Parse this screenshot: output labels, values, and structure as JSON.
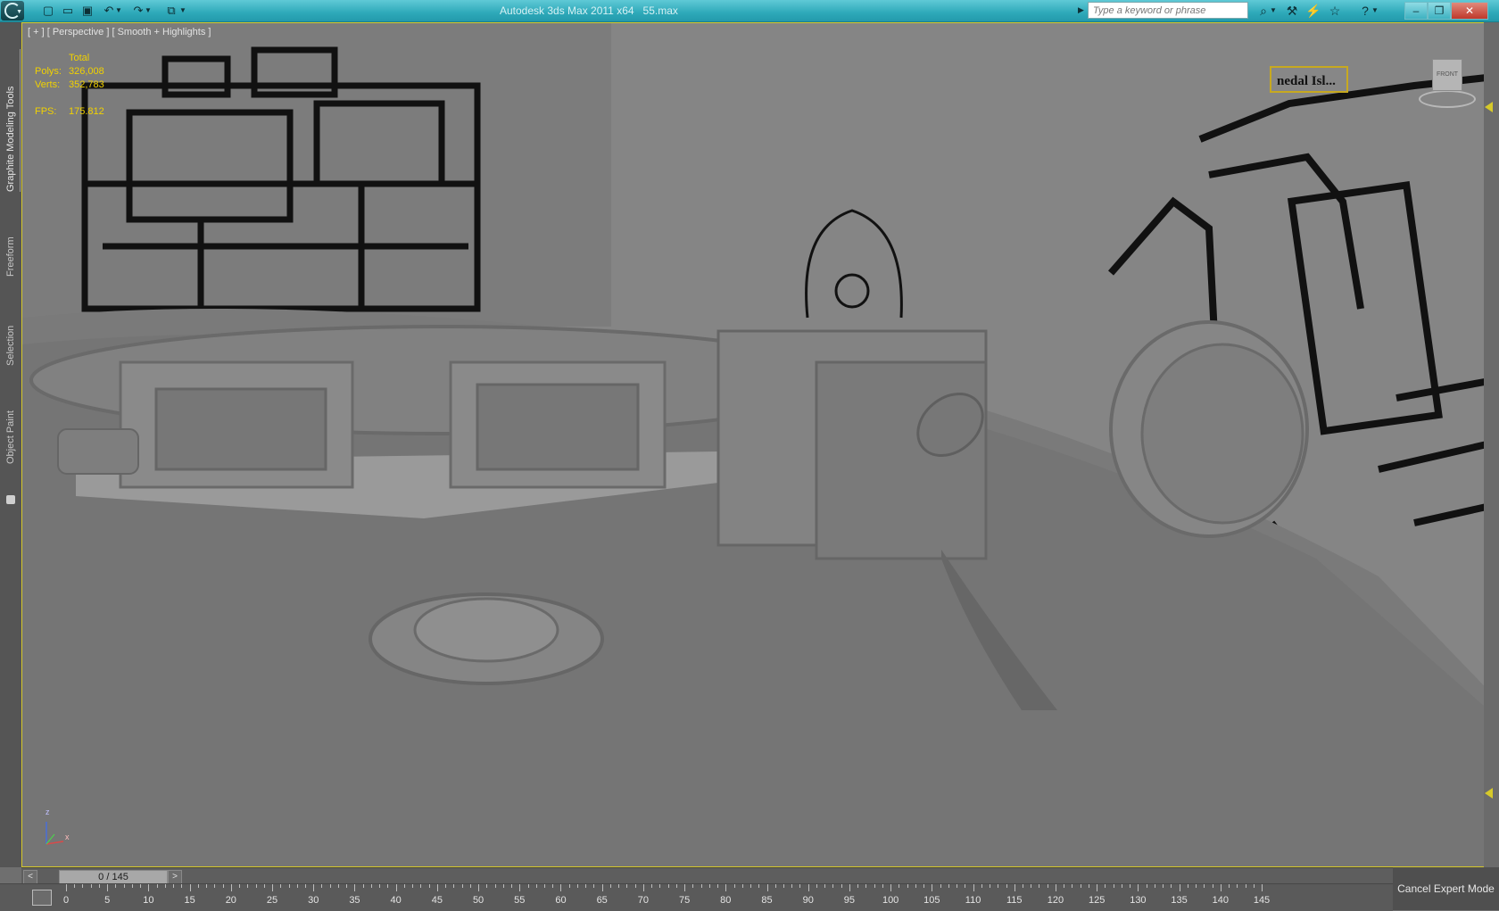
{
  "titlebar": {
    "app_title": "Autodesk 3ds Max  2011 x64",
    "file_name": "55.max",
    "search_placeholder": "Type a keyword or phrase"
  },
  "ribbon_tabs": [
    "Graphite Modeling Tools",
    "Freeform",
    "Selection",
    "Object Paint"
  ],
  "viewport": {
    "label": "[ + ] [ Perspective ] [ Smooth + Highlights ]",
    "stats": {
      "header": "Total",
      "polys_label": "Polys:",
      "polys_value": "326,008",
      "verts_label": "Verts:",
      "verts_value": "352,783",
      "fps_label": "FPS:",
      "fps_value": "175.812"
    },
    "name_overlay": "nedal Isl...",
    "viewcube_label": "FRONT",
    "axis": {
      "z": "z",
      "x": "x"
    }
  },
  "timeline": {
    "frame_display": "0 / 145",
    "prev_label": "<",
    "next_label": ">",
    "ticks": [
      0,
      5,
      10,
      15,
      20,
      25,
      30,
      35,
      40,
      45,
      50,
      55,
      60,
      65,
      70,
      75,
      80,
      85,
      90,
      95,
      100,
      105,
      110,
      115,
      120,
      125,
      130,
      135,
      140,
      145
    ],
    "max_frame": 145
  },
  "expert_mode": {
    "label": "Cancel Expert Mode"
  },
  "colors": {
    "title_bar": "#2ea9b9",
    "viewport_border": "#d6c92a",
    "stats_text": "#f1d100"
  }
}
